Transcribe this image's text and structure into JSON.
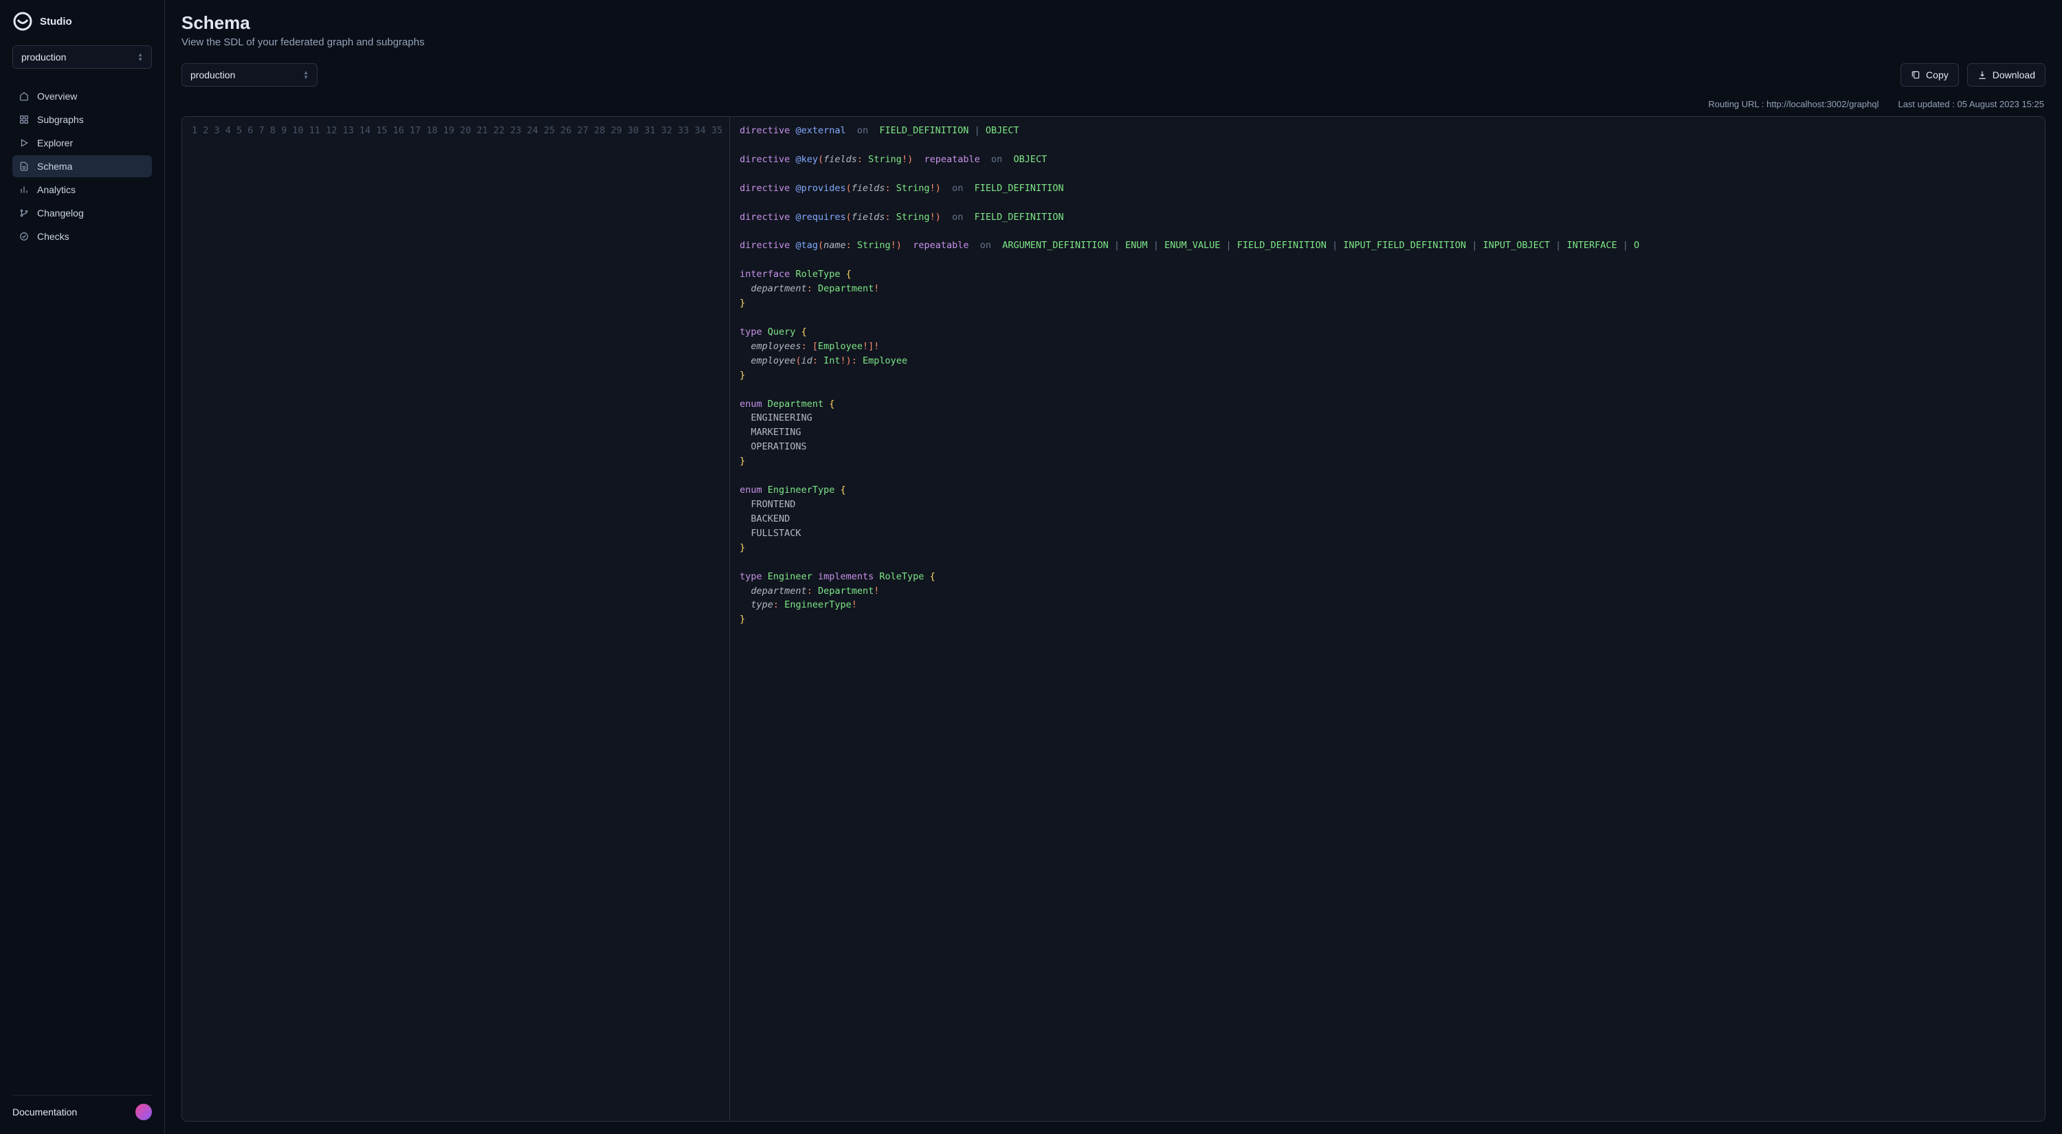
{
  "brand": {
    "name": "Studio"
  },
  "env": {
    "selected": "production"
  },
  "nav": {
    "overview": "Overview",
    "subgraphs": "Subgraphs",
    "explorer": "Explorer",
    "schema": "Schema",
    "analytics": "Analytics",
    "changelog": "Changelog",
    "checks": "Checks"
  },
  "footer": {
    "documentation": "Documentation"
  },
  "page": {
    "title": "Schema",
    "subtitle": "View the SDL of your federated graph and subgraphs"
  },
  "toolbar": {
    "graph_selected": "production",
    "copy_label": "Copy",
    "download_label": "Download"
  },
  "meta": {
    "routing_label": "Routing URL : ",
    "routing_value": "http://localhost:3002/graphql",
    "updated_label": "Last updated : ",
    "updated_value": "05 August 2023 15:25"
  },
  "code": {
    "total_lines": 35,
    "lines": [
      [
        [
          "dir",
          "directive"
        ],
        [
          "sp",
          " "
        ],
        [
          "at",
          "@external"
        ],
        [
          "sp",
          "  "
        ],
        [
          "on",
          "on"
        ],
        [
          "sp",
          "  "
        ],
        [
          "enum",
          "FIELD_DEFINITION"
        ],
        [
          "sp",
          " "
        ],
        [
          "pipe",
          "|"
        ],
        [
          "sp",
          " "
        ],
        [
          "enum",
          "OBJECT"
        ]
      ],
      [],
      [
        [
          "dir",
          "directive"
        ],
        [
          "sp",
          " "
        ],
        [
          "at",
          "@key"
        ],
        [
          "punc",
          "("
        ],
        [
          "param",
          "fields"
        ],
        [
          "punc",
          ":"
        ],
        [
          "sp",
          " "
        ],
        [
          "type",
          "String"
        ],
        [
          "punc",
          "!)"
        ],
        [
          "sp",
          "  "
        ],
        [
          "kw",
          "repeatable"
        ],
        [
          "sp",
          "  "
        ],
        [
          "on",
          "on"
        ],
        [
          "sp",
          "  "
        ],
        [
          "enum",
          "OBJECT"
        ]
      ],
      [],
      [
        [
          "dir",
          "directive"
        ],
        [
          "sp",
          " "
        ],
        [
          "at",
          "@provides"
        ],
        [
          "punc",
          "("
        ],
        [
          "param",
          "fields"
        ],
        [
          "punc",
          ":"
        ],
        [
          "sp",
          " "
        ],
        [
          "type",
          "String"
        ],
        [
          "punc",
          "!)"
        ],
        [
          "sp",
          "  "
        ],
        [
          "on",
          "on"
        ],
        [
          "sp",
          "  "
        ],
        [
          "enum",
          "FIELD_DEFINITION"
        ]
      ],
      [],
      [
        [
          "dir",
          "directive"
        ],
        [
          "sp",
          " "
        ],
        [
          "at",
          "@requires"
        ],
        [
          "punc",
          "("
        ],
        [
          "param",
          "fields"
        ],
        [
          "punc",
          ":"
        ],
        [
          "sp",
          " "
        ],
        [
          "type",
          "String"
        ],
        [
          "punc",
          "!)"
        ],
        [
          "sp",
          "  "
        ],
        [
          "on",
          "on"
        ],
        [
          "sp",
          "  "
        ],
        [
          "enum",
          "FIELD_DEFINITION"
        ]
      ],
      [],
      [
        [
          "dir",
          "directive"
        ],
        [
          "sp",
          " "
        ],
        [
          "at",
          "@tag"
        ],
        [
          "punc",
          "("
        ],
        [
          "param",
          "name"
        ],
        [
          "punc",
          ":"
        ],
        [
          "sp",
          " "
        ],
        [
          "type",
          "String"
        ],
        [
          "punc",
          "!)"
        ],
        [
          "sp",
          "  "
        ],
        [
          "kw",
          "repeatable"
        ],
        [
          "sp",
          "  "
        ],
        [
          "on",
          "on"
        ],
        [
          "sp",
          "  "
        ],
        [
          "enum",
          "ARGUMENT_DEFINITION"
        ],
        [
          "sp",
          " "
        ],
        [
          "pipe",
          "|"
        ],
        [
          "sp",
          " "
        ],
        [
          "enum",
          "ENUM"
        ],
        [
          "sp",
          " "
        ],
        [
          "pipe",
          "|"
        ],
        [
          "sp",
          " "
        ],
        [
          "enum",
          "ENUM_VALUE"
        ],
        [
          "sp",
          " "
        ],
        [
          "pipe",
          "|"
        ],
        [
          "sp",
          " "
        ],
        [
          "enum",
          "FIELD_DEFINITION"
        ],
        [
          "sp",
          " "
        ],
        [
          "pipe",
          "|"
        ],
        [
          "sp",
          " "
        ],
        [
          "enum",
          "INPUT_FIELD_DEFINITION"
        ],
        [
          "sp",
          " "
        ],
        [
          "pipe",
          "|"
        ],
        [
          "sp",
          " "
        ],
        [
          "enum",
          "INPUT_OBJECT"
        ],
        [
          "sp",
          " "
        ],
        [
          "pipe",
          "|"
        ],
        [
          "sp",
          " "
        ],
        [
          "enum",
          "INTERFACE"
        ],
        [
          "sp",
          " "
        ],
        [
          "pipe",
          "|"
        ],
        [
          "sp",
          " "
        ],
        [
          "enum",
          "O"
        ]
      ],
      [],
      [
        [
          "kw",
          "interface"
        ],
        [
          "sp",
          " "
        ],
        [
          "type",
          "RoleType"
        ],
        [
          "sp",
          " "
        ],
        [
          "brace",
          "{"
        ]
      ],
      [
        [
          "sp",
          "  "
        ],
        [
          "param",
          "department"
        ],
        [
          "punc",
          ":"
        ],
        [
          "sp",
          " "
        ],
        [
          "type",
          "Department"
        ],
        [
          "punc",
          "!"
        ]
      ],
      [
        [
          "brace",
          "}"
        ]
      ],
      [],
      [
        [
          "kw",
          "type"
        ],
        [
          "sp",
          " "
        ],
        [
          "type",
          "Query"
        ],
        [
          "sp",
          " "
        ],
        [
          "brace",
          "{"
        ]
      ],
      [
        [
          "sp",
          "  "
        ],
        [
          "param",
          "employees"
        ],
        [
          "punc",
          ":"
        ],
        [
          "sp",
          " "
        ],
        [
          "punc",
          "["
        ],
        [
          "type",
          "Employee"
        ],
        [
          "punc",
          "!]!"
        ]
      ],
      [
        [
          "sp",
          "  "
        ],
        [
          "param",
          "employee"
        ],
        [
          "punc",
          "("
        ],
        [
          "param",
          "id"
        ],
        [
          "punc",
          ":"
        ],
        [
          "sp",
          " "
        ],
        [
          "type",
          "Int"
        ],
        [
          "punc",
          "!):"
        ],
        [
          "sp",
          " "
        ],
        [
          "type",
          "Employee"
        ]
      ],
      [
        [
          "brace",
          "}"
        ]
      ],
      [],
      [
        [
          "kw",
          "enum"
        ],
        [
          "sp",
          " "
        ],
        [
          "type",
          "Department"
        ],
        [
          "sp",
          " "
        ],
        [
          "brace",
          "{"
        ]
      ],
      [
        [
          "sp",
          "  "
        ],
        [
          "id",
          "ENGINEERING"
        ]
      ],
      [
        [
          "sp",
          "  "
        ],
        [
          "id",
          "MARKETING"
        ]
      ],
      [
        [
          "sp",
          "  "
        ],
        [
          "id",
          "OPERATIONS"
        ]
      ],
      [
        [
          "brace",
          "}"
        ]
      ],
      [],
      [
        [
          "kw",
          "enum"
        ],
        [
          "sp",
          " "
        ],
        [
          "type",
          "EngineerType"
        ],
        [
          "sp",
          " "
        ],
        [
          "brace",
          "{"
        ]
      ],
      [
        [
          "sp",
          "  "
        ],
        [
          "id",
          "FRONTEND"
        ]
      ],
      [
        [
          "sp",
          "  "
        ],
        [
          "id",
          "BACKEND"
        ]
      ],
      [
        [
          "sp",
          "  "
        ],
        [
          "id",
          "FULLSTACK"
        ]
      ],
      [
        [
          "brace",
          "}"
        ]
      ],
      [],
      [
        [
          "kw",
          "type"
        ],
        [
          "sp",
          " "
        ],
        [
          "type",
          "Engineer"
        ],
        [
          "sp",
          " "
        ],
        [
          "kw",
          "implements"
        ],
        [
          "sp",
          " "
        ],
        [
          "type",
          "RoleType"
        ],
        [
          "sp",
          " "
        ],
        [
          "brace",
          "{"
        ]
      ],
      [
        [
          "sp",
          "  "
        ],
        [
          "param",
          "department"
        ],
        [
          "punc",
          ":"
        ],
        [
          "sp",
          " "
        ],
        [
          "type",
          "Department"
        ],
        [
          "punc",
          "!"
        ]
      ],
      [
        [
          "sp",
          "  "
        ],
        [
          "param",
          "type"
        ],
        [
          "punc",
          ":"
        ],
        [
          "sp",
          " "
        ],
        [
          "type",
          "EngineerType"
        ],
        [
          "punc",
          "!"
        ]
      ],
      [
        [
          "brace",
          "}"
        ]
      ]
    ]
  }
}
